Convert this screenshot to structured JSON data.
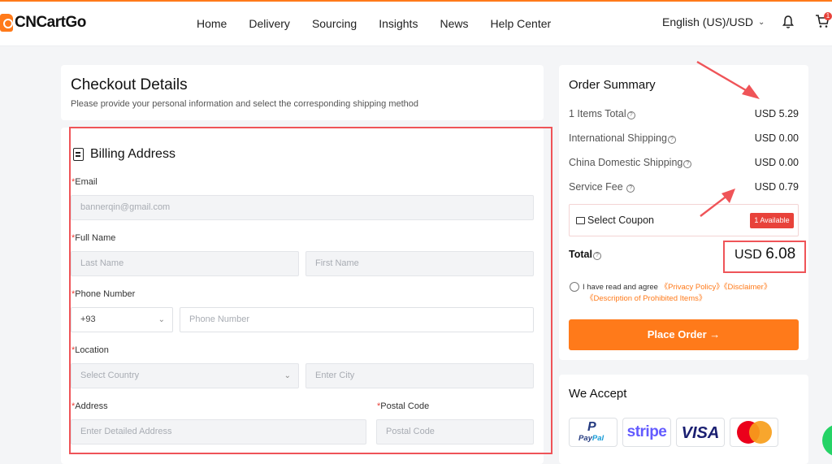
{
  "brand": {
    "name": "CNCartGo",
    "accent": "#ff7a1a"
  },
  "nav": [
    "Home",
    "Delivery",
    "Sourcing",
    "Insights",
    "News",
    "Help Center"
  ],
  "header": {
    "language": "English (US)/USD",
    "cart_count": "1"
  },
  "checkout": {
    "title": "Checkout Details",
    "subtitle": "Please provide your personal information and select the corresponding shipping method"
  },
  "billing": {
    "title": "Billing Address",
    "required_mark": "*",
    "email_label": "Email",
    "email_value": "bannerqin@gmail.com",
    "fullname_label": "Full Name",
    "last_name_placeholder": "Last Name",
    "first_name_placeholder": "First Name",
    "phone_label": "Phone Number",
    "phone_code": "+93",
    "phone_placeholder": "Phone Number",
    "location_label": "Location",
    "country_placeholder": "Select Country",
    "city_placeholder": "Enter City",
    "address_label": "Address",
    "address_placeholder": "Enter Detailed Address",
    "postal_label": "Postal Code",
    "postal_placeholder": "Postal Code"
  },
  "summary": {
    "title": "Order Summary",
    "rows": [
      {
        "label": "1 Items Total",
        "value": "USD 5.29"
      },
      {
        "label": "International Shipping",
        "value": "USD 0.00"
      },
      {
        "label": "China Domestic Shipping",
        "value": "USD 0.00"
      },
      {
        "label": "Service Fee ",
        "value": "USD 0.79"
      }
    ],
    "coupon_label": "Select Coupon",
    "coupon_available": "1 Available",
    "total_label": "Total",
    "total_currency": "USD ",
    "total_amount": "6.08",
    "agree_text": "I have read and agree ",
    "privacy_link": "《Privacy Policy》",
    "disclaimer_link": "《Disclaimer》",
    "prohibited_link": "《Description of Prohibited Items》",
    "place_order": "Place Order →"
  },
  "accept": {
    "title": "We Accept",
    "methods": [
      "PayPal",
      "stripe",
      "VISA",
      "Mastercard"
    ]
  }
}
